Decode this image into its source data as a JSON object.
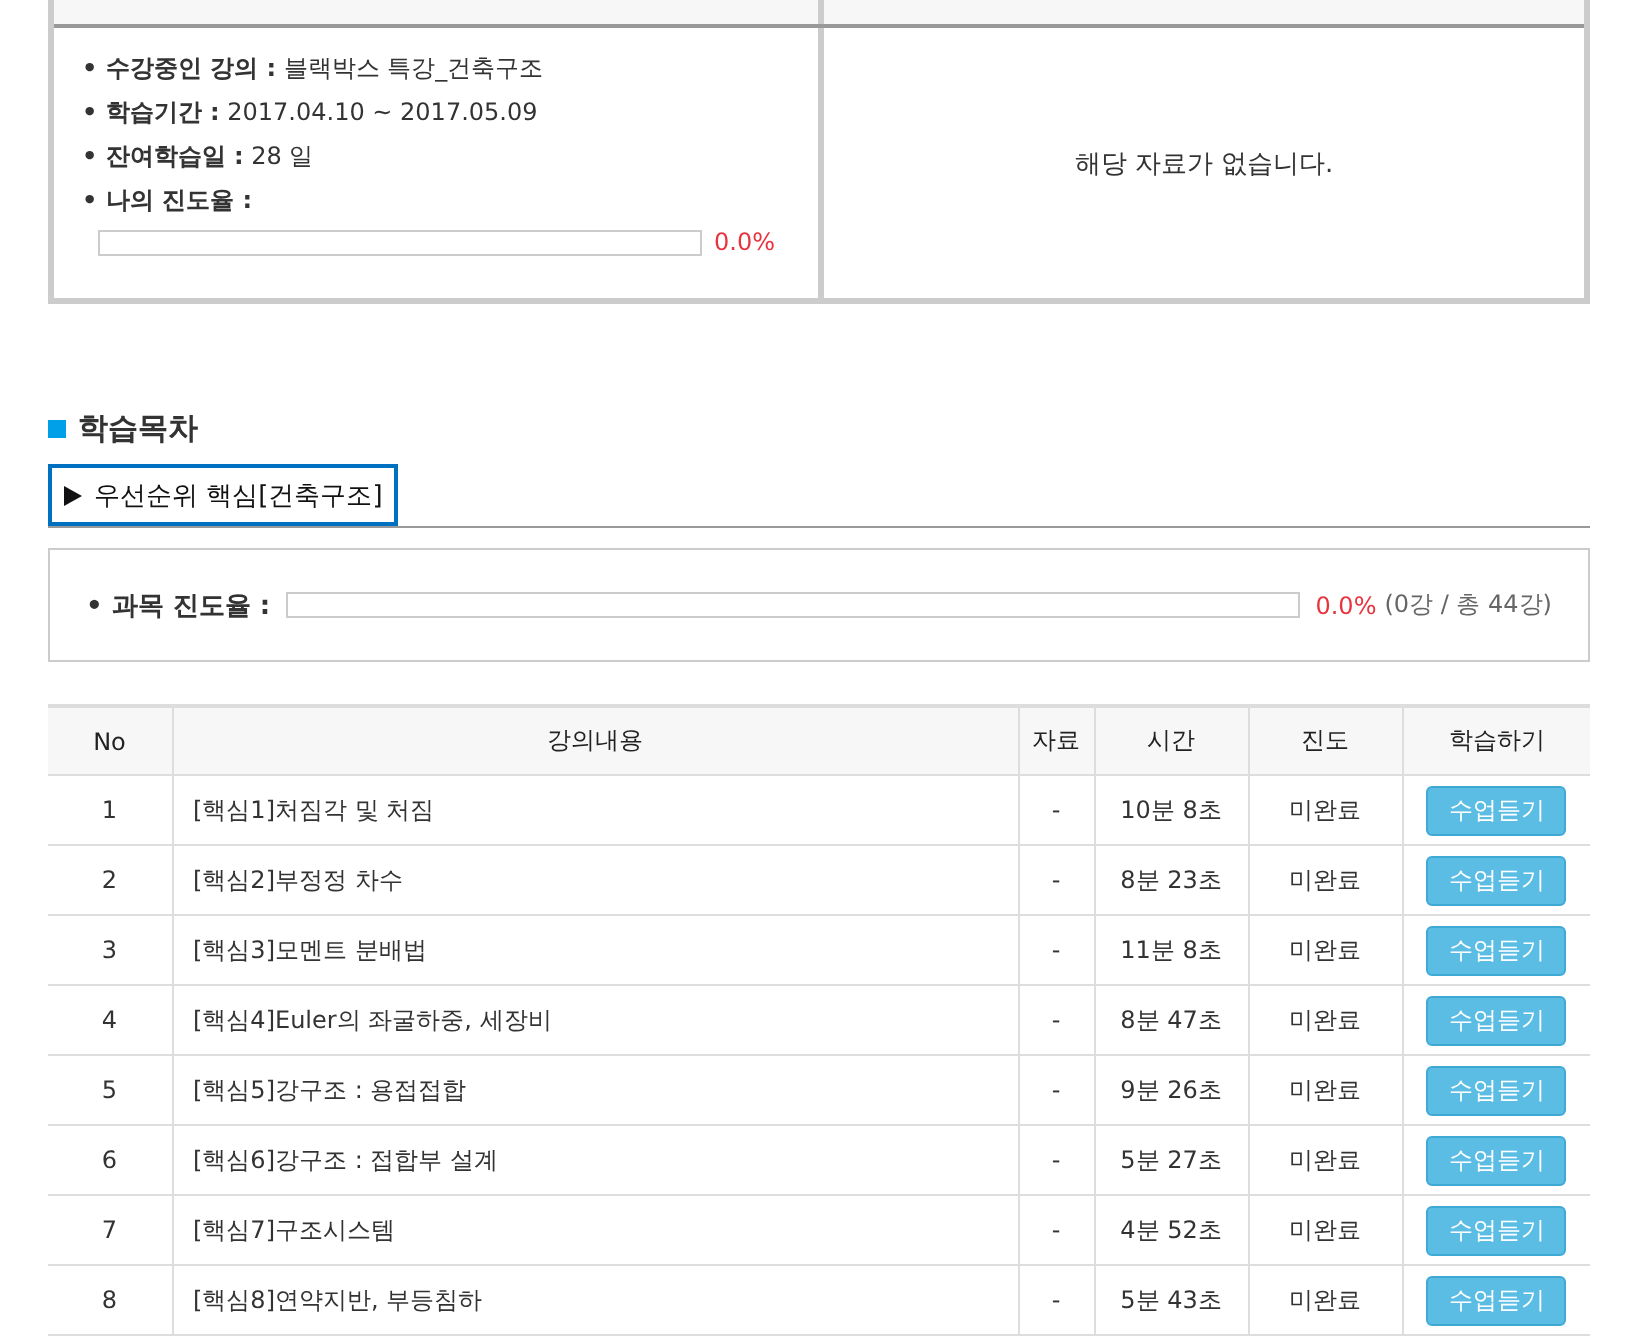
{
  "course_info": {
    "items": [
      {
        "label": "• 수강중인 강의 :",
        "value": "블랙박스 특강_건축구조"
      },
      {
        "label": "• 학습기간 :",
        "value": "2017.04.10 ~ 2017.05.09"
      },
      {
        "label": "• 잔여학습일 :",
        "value": "28 일"
      }
    ],
    "progress": {
      "label": "• 나의 진도율 :",
      "level": 0,
      "reading": "0.0%"
    }
  },
  "materials": {
    "message": "해당 자료가 없습니다."
  },
  "section_title": "학습목차",
  "tabs": [
    {
      "label": "우선순위 핵심[건축구조]",
      "selected": true
    }
  ],
  "subject_progress": {
    "label": "• 과목 진도율 :",
    "level": 0,
    "reading": "0.0%",
    "count": "(0강 / 총 44강)"
  },
  "table": {
    "columns": [
      "No",
      "강의내용",
      "자료",
      "시간",
      "진도",
      "학습하기"
    ],
    "rows": [
      {
        "no": "1",
        "title": "[핵심1]처짐각 및 처짐",
        "material": "-",
        "time": "10분 8초",
        "status": "미완료",
        "button": "수업듣기"
      },
      {
        "no": "2",
        "title": "[핵심2]부정정 차수",
        "material": "-",
        "time": "8분 23초",
        "status": "미완료",
        "button": "수업듣기"
      },
      {
        "no": "3",
        "title": "[핵심3]모멘트 분배법",
        "material": "-",
        "time": "11분 8초",
        "status": "미완료",
        "button": "수업듣기"
      },
      {
        "no": "4",
        "title": "[핵심4]Euler의 좌굴하중, 세장비",
        "material": "-",
        "time": "8분 47초",
        "status": "미완료",
        "button": "수업듣기"
      },
      {
        "no": "5",
        "title": "[핵심5]강구조 : 용접접합",
        "material": "-",
        "time": "9분 26초",
        "status": "미완료",
        "button": "수업듣기"
      },
      {
        "no": "6",
        "title": "[핵심6]강구조 : 접합부 설계",
        "material": "-",
        "time": "5분 27초",
        "status": "미완료",
        "button": "수업듣기"
      },
      {
        "no": "7",
        "title": "[핵심7]구조시스템",
        "material": "-",
        "time": "4분 52초",
        "status": "미완료",
        "button": "수업듣기"
      },
      {
        "no": "8",
        "title": "[핵심8]연약지반, 부등침하",
        "material": "-",
        "time": "5분 43초",
        "status": "미완료",
        "button": "수업듣기"
      }
    ]
  }
}
